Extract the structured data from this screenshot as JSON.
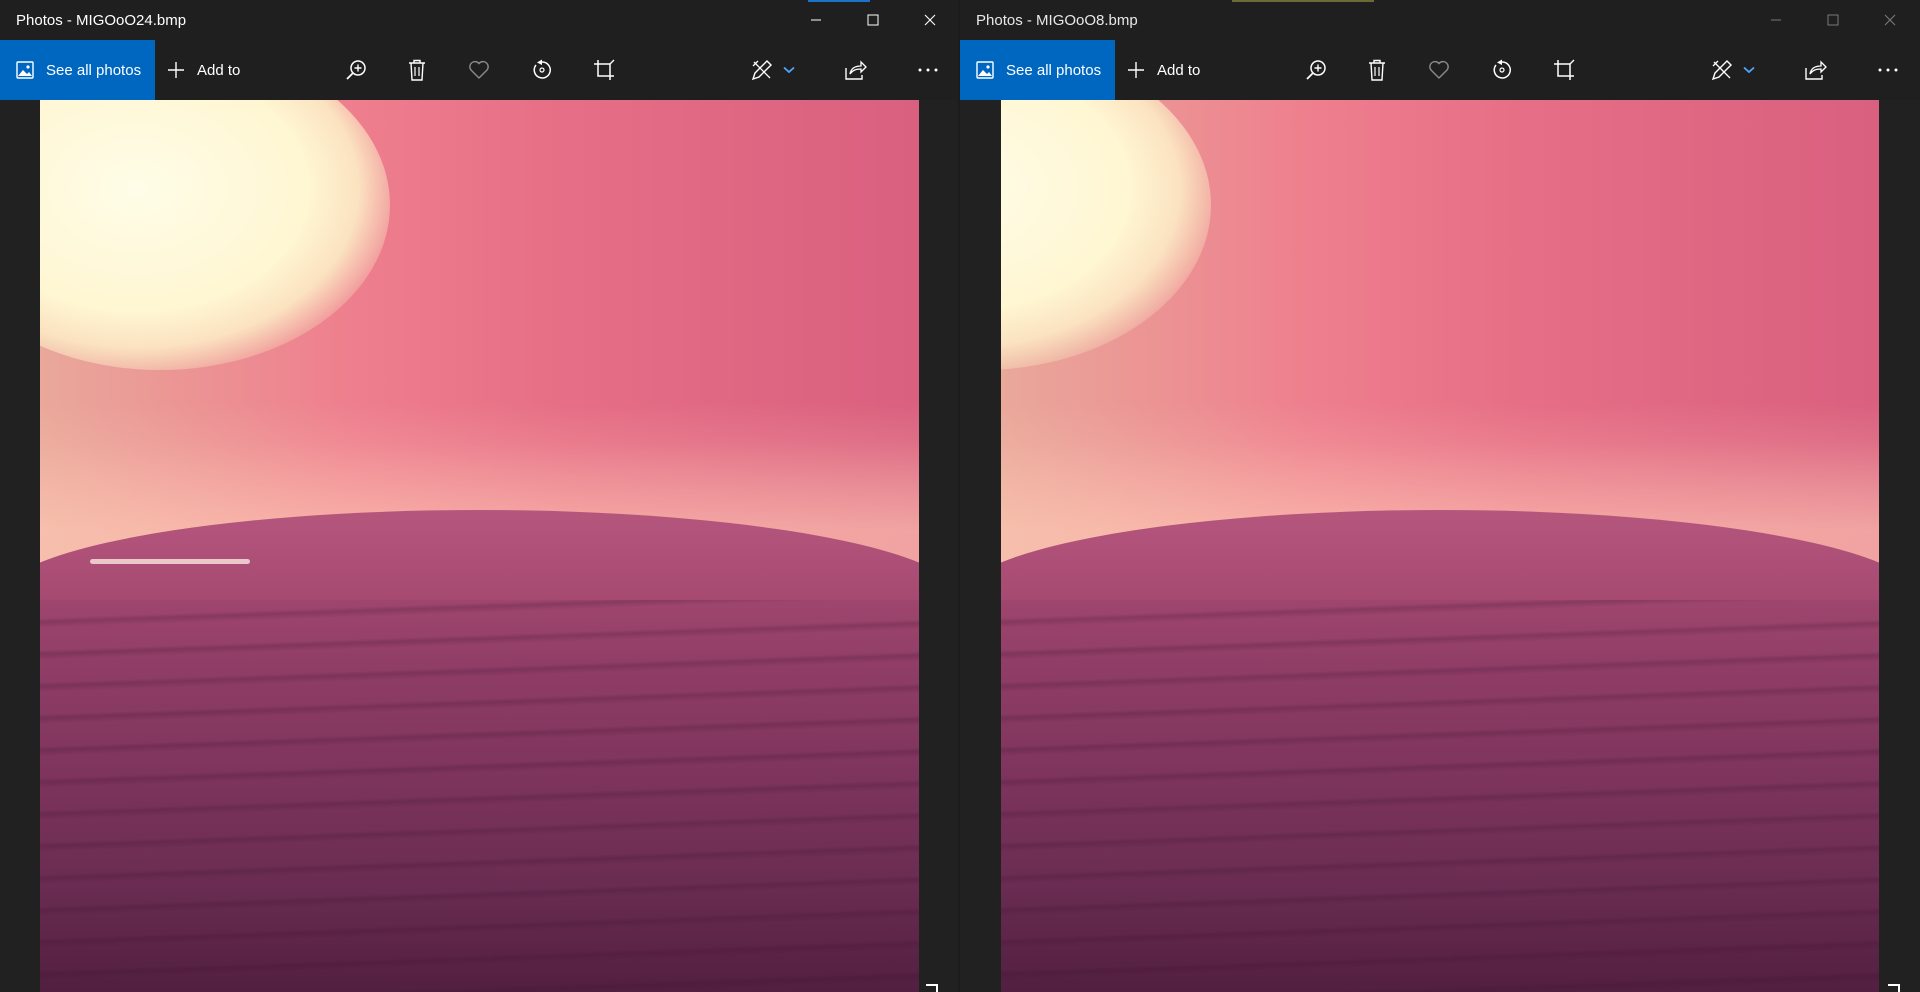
{
  "windows": [
    {
      "title": "Photos - MIGOoO24.bmp",
      "active": true,
      "toolbar": {
        "see_all_label": "See all photos",
        "add_to_label": "Add to"
      },
      "icons": [
        "photos-icon",
        "plus-icon",
        "zoom-in-icon",
        "delete-icon",
        "favorite-icon",
        "rotate-icon",
        "crop-icon",
        "edit-draw-icon",
        "chevron-down-icon",
        "share-icon",
        "more-icon",
        "minimize-icon",
        "maximize-icon",
        "close-icon"
      ]
    },
    {
      "title": "Photos - MIGOoO8.bmp",
      "active": false,
      "toolbar": {
        "see_all_label": "See all photos",
        "add_to_label": "Add to"
      },
      "icons": [
        "photos-icon",
        "plus-icon",
        "zoom-in-icon",
        "delete-icon",
        "favorite-icon",
        "rotate-icon",
        "crop-icon",
        "edit-draw-icon",
        "chevron-down-icon",
        "share-icon",
        "more-icon",
        "minimize-icon",
        "maximize-icon",
        "close-icon"
      ]
    }
  ],
  "colors": {
    "accent": "#0067c0",
    "titlebar_bg": "#1f1f1f",
    "viewport_bg": "#212121",
    "sky_pink": "#e66e86",
    "sun_cream": "#fff6d2",
    "sea_purple": "#7d345c"
  }
}
